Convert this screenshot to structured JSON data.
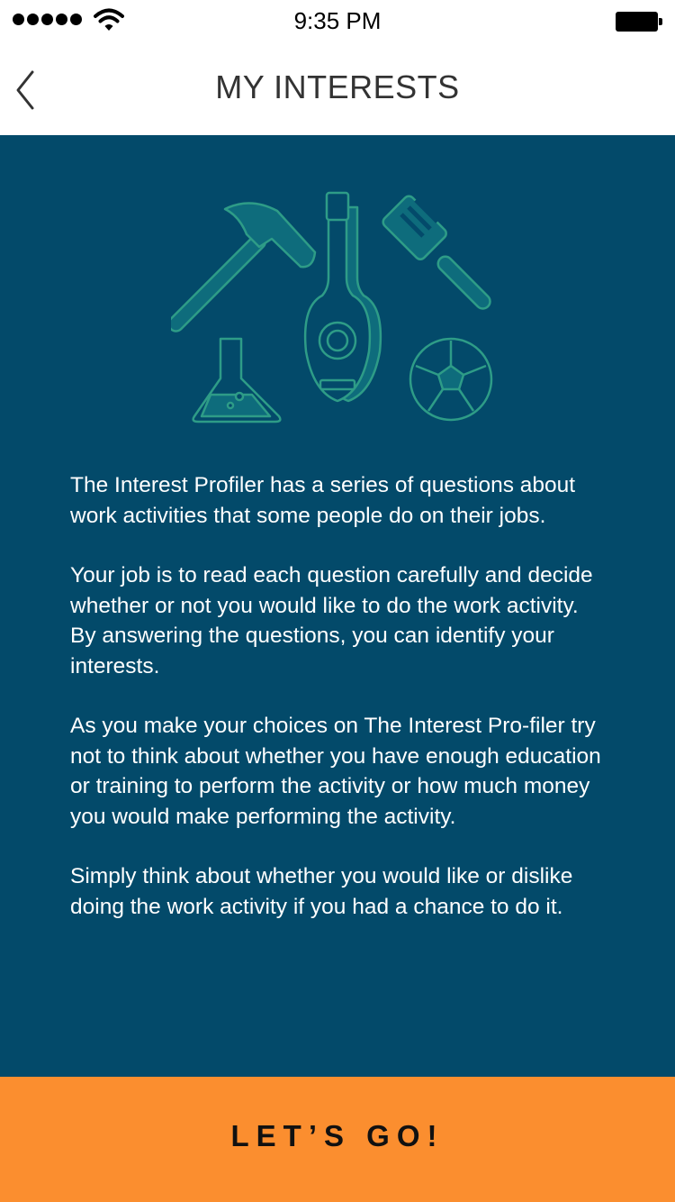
{
  "status_bar": {
    "time": "9:35 PM",
    "signal_icon": "signal-dots-icon",
    "wifi_icon": "wifi-icon",
    "battery_icon": "battery-icon",
    "battery_level": 1.0
  },
  "nav": {
    "back_icon": "chevron-left-icon",
    "title": "MY INTERESTS"
  },
  "illustration": {
    "icons": [
      "hammer-icon",
      "guitar-icon",
      "spatula-icon",
      "flask-icon",
      "soccer-ball-icon"
    ],
    "stroke_color": "#2E9C87",
    "fill_color": "#0E6C7C"
  },
  "content": {
    "background_color": "#034A6A",
    "paragraphs": [
      "The Interest Profiler has a series of questions about work activities that some people do on their jobs.",
      "Your job is to read each question carefully and decide whether or not you would like to do the work activity. By answering the questions, you can identify your interests.",
      "As you make your choices on The Interest Pro-filer try not to think about whether you have enough education or training to perform the activity or how much money you would make performing the activity.",
      "Simply think about whether you would like or dislike doing the work activity if you had a chance to do it."
    ]
  },
  "cta": {
    "label": "LET’S GO!",
    "color": "#FB8E2F"
  }
}
